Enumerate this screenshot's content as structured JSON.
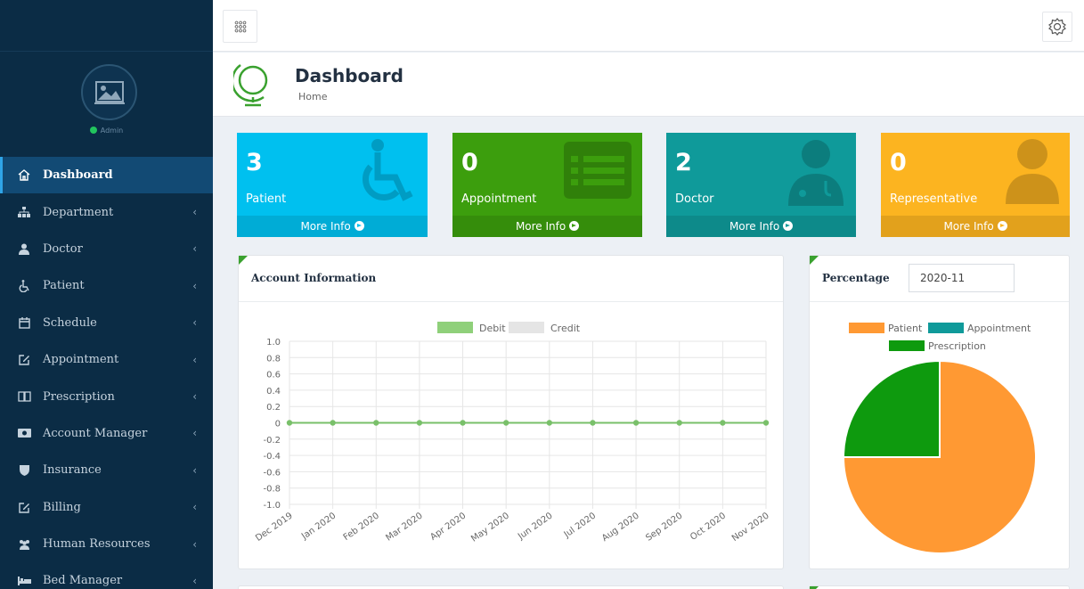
{
  "sidebar": {
    "status_text": "Admin",
    "items": [
      {
        "label": "Dashboard",
        "icon": "home-icon",
        "active": true
      },
      {
        "label": "Department",
        "icon": "sitemap-icon"
      },
      {
        "label": "Doctor",
        "icon": "user-md-icon"
      },
      {
        "label": "Patient",
        "icon": "wheelchair-icon"
      },
      {
        "label": "Schedule",
        "icon": "calendar-icon"
      },
      {
        "label": "Appointment",
        "icon": "edit-icon"
      },
      {
        "label": "Prescription",
        "icon": "book-icon"
      },
      {
        "label": "Account Manager",
        "icon": "money-icon"
      },
      {
        "label": "Insurance",
        "icon": "shield-icon"
      },
      {
        "label": "Billing",
        "icon": "pencil-square-icon"
      },
      {
        "label": "Human Resources",
        "icon": "users-icon"
      },
      {
        "label": "Bed Manager",
        "icon": "bed-icon"
      }
    ]
  },
  "header": {
    "title": "Dashboard",
    "breadcrumb": "Home"
  },
  "boxes": [
    {
      "value": "3",
      "label": "Patient",
      "footer": "More Info",
      "color": "#00c0ef",
      "icon": "wheelchair-icon"
    },
    {
      "value": "0",
      "label": "Appointment",
      "footer": "More Info",
      "color": "#3c9e0d",
      "icon": "list-alt-icon"
    },
    {
      "value": "2",
      "label": "Doctor",
      "footer": "More Info",
      "color": "#0f9a9a",
      "icon": "user-md-icon"
    },
    {
      "value": "0",
      "label": "Representative",
      "footer": "More Info",
      "color": "#fcb420",
      "icon": "user-icon"
    }
  ],
  "account_panel": {
    "title": "Account Information"
  },
  "percentage_panel": {
    "title": "Percentage",
    "month_value": "2020-11"
  },
  "chart_data": [
    {
      "type": "line",
      "x": [
        "Dec 2019",
        "Jan 2020",
        "Feb 2020",
        "Mar 2020",
        "Apr 2020",
        "May 2020",
        "Jun 2020",
        "Jul 2020",
        "Aug 2020",
        "Sep 2020",
        "Oct 2020",
        "Nov 2020"
      ],
      "series": [
        {
          "name": "Debit",
          "values": [
            0,
            0,
            0,
            0,
            0,
            0,
            0,
            0,
            0,
            0,
            0,
            0
          ],
          "color": "#8fd07a"
        },
        {
          "name": "Credit",
          "values": [
            0,
            0,
            0,
            0,
            0,
            0,
            0,
            0,
            0,
            0,
            0,
            0
          ],
          "color": "#e5e5e5"
        }
      ],
      "yticks": [
        "1.0",
        "0.8",
        "0.6",
        "0.4",
        "0.2",
        "0",
        "-0.2",
        "-0.4",
        "-0.6",
        "-0.8",
        "-1.0"
      ],
      "ylim": [
        -1,
        1
      ],
      "grid": true,
      "legend": "top"
    },
    {
      "type": "pie",
      "categories": [
        "Patient",
        "Appointment",
        "Prescription"
      ],
      "values": [
        3,
        0,
        1
      ],
      "colors": [
        "#ff9933",
        "#0f9a9a",
        "#0e9a0e"
      ],
      "legend": "top"
    }
  ]
}
